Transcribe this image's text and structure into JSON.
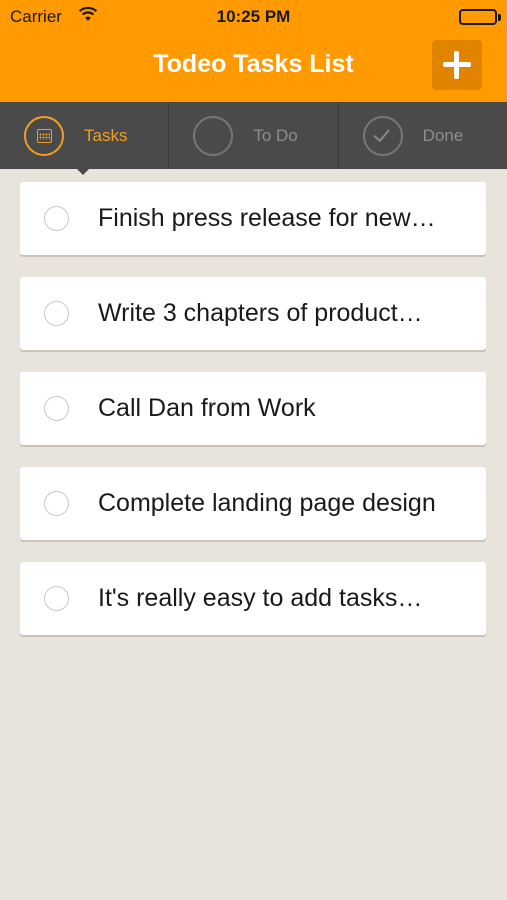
{
  "status_bar": {
    "carrier": "Carrier",
    "time": "10:25 PM"
  },
  "header": {
    "title": "Todeo Tasks List",
    "add_icon": "plus-icon",
    "accent_color": "#ff9a00"
  },
  "tabs": [
    {
      "label": "Tasks",
      "icon": "calendar-icon",
      "active": true
    },
    {
      "label": "To Do",
      "icon": "circle-icon",
      "active": false
    },
    {
      "label": "Done",
      "icon": "checkmark-icon",
      "active": false
    }
  ],
  "tasks": [
    {
      "text": "Finish press release for new…",
      "completed": false
    },
    {
      "text": "Write 3 chapters of product…",
      "completed": false
    },
    {
      "text": "Call Dan from Work",
      "completed": false
    },
    {
      "text": "Complete landing page design",
      "completed": false
    },
    {
      "text": "It's really easy to add tasks…",
      "completed": false
    }
  ]
}
